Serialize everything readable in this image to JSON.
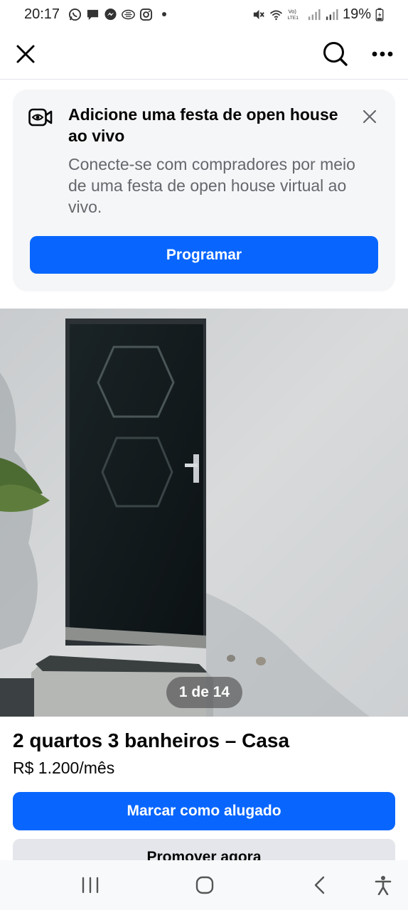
{
  "status_bar": {
    "time": "20:17",
    "battery": "19%",
    "left_icons": [
      "whatsapp-icon",
      "chat-icon",
      "messenger-icon",
      "app-icon",
      "instagram-icon",
      "dot-icon"
    ],
    "right_icons": [
      "mute-icon",
      "wifi-icon",
      "volte-icon",
      "signal-icon",
      "signal-icon",
      "battery-icon"
    ],
    "volte_label": "Vo) LTE1"
  },
  "header": {
    "close_icon": "close-icon",
    "search_icon": "search-icon",
    "more_icon": "more-icon"
  },
  "banner": {
    "title": "Adicione uma festa de open house ao vivo",
    "description": "Conecte-se com compradores por meio de uma festa de open house virtual ao vivo.",
    "button_label": "Programar",
    "icon": "live-video-icon"
  },
  "photo": {
    "counter": "1 de 14"
  },
  "listing": {
    "title": "2 quartos 3 banheiros – Casa",
    "price": "R$ 1.200/mês",
    "mark_rented_label": "Marcar como alugado",
    "promote_label": "Promover agora"
  },
  "nav_bar": {
    "icons": [
      "recents-icon",
      "home-icon",
      "back-icon",
      "accessibility-icon"
    ]
  },
  "colors": {
    "primary": "#0866ff",
    "secondary_button": "#e4e6eb",
    "banner_bg": "#f5f6f8",
    "text_primary": "#050505",
    "text_secondary": "#65676b"
  }
}
